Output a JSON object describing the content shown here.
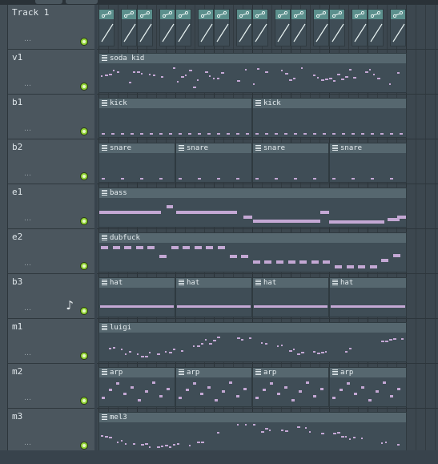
{
  "colors": {
    "background": "#38434c",
    "clip_header": "#56676f",
    "note": "#c4a8d4",
    "led": "#8fd334",
    "automation_header": "#5b8f8c"
  },
  "tracks": [
    {
      "name": "Track 1",
      "clips": [],
      "automation": true
    },
    {
      "name": "v1",
      "clips": [
        {
          "label": "soda kid"
        }
      ]
    },
    {
      "name": "b1",
      "clips": [
        {
          "label": "kick"
        },
        {
          "label": "kick"
        }
      ]
    },
    {
      "name": "b2",
      "clips": [
        {
          "label": "snare"
        },
        {
          "label": "snare"
        },
        {
          "label": "snare"
        },
        {
          "label": "snare"
        }
      ]
    },
    {
      "name": "e1",
      "clips": [
        {
          "label": "bass"
        }
      ]
    },
    {
      "name": "e2",
      "clips": [
        {
          "label": "dubfuck"
        }
      ]
    },
    {
      "name": "b3",
      "clips": [
        {
          "label": "hat"
        },
        {
          "label": "hat"
        },
        {
          "label": "hat"
        },
        {
          "label": "hat"
        }
      ],
      "has_note_icon": true
    },
    {
      "name": "m1",
      "clips": [
        {
          "label": "luigi"
        }
      ]
    },
    {
      "name": "m2",
      "clips": [
        {
          "label": "arp"
        },
        {
          "label": "arp"
        },
        {
          "label": "arp"
        },
        {
          "label": "arp"
        }
      ]
    },
    {
      "name": "m3",
      "clips": [
        {
          "label": "mel3"
        }
      ]
    }
  ],
  "icons": {
    "automation": "automation-curve-icon",
    "mute": "mute-led-icon",
    "clip": "clip-menu-icon",
    "note": "music-note-icon"
  }
}
